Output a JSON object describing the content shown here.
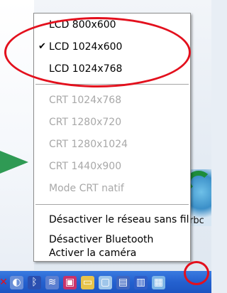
{
  "menu": {
    "items": [
      {
        "label": "LCD 800x600",
        "checked": false,
        "disabled": false
      },
      {
        "label": "LCD 1024x600",
        "checked": true,
        "disabled": false
      },
      {
        "label": "LCD 1024x768",
        "checked": false,
        "disabled": false
      },
      {
        "label": "CRT 1024x768",
        "checked": false,
        "disabled": true
      },
      {
        "label": "CRT 1280x720",
        "checked": false,
        "disabled": true
      },
      {
        "label": "CRT 1280x1024",
        "checked": false,
        "disabled": true
      },
      {
        "label": "CRT 1440x900",
        "checked": false,
        "disabled": true
      },
      {
        "label": "Mode CRT natif",
        "checked": false,
        "disabled": true
      },
      {
        "label": "Désactiver le réseau sans fil",
        "checked": false,
        "disabled": false
      },
      {
        "label": "Désactiver Bluetooth",
        "checked": false,
        "disabled": false
      },
      {
        "label": "Activer la caméra",
        "checked": false,
        "disabled": false
      }
    ],
    "check_glyph": "✔"
  },
  "desktop": {
    "right_icon_label": "rbc"
  },
  "taskbar": {
    "tray_icons": [
      "close-x-icon",
      "network-icon",
      "bluetooth-icon",
      "wireless-icon",
      "app-icon",
      "folder-icon",
      "monitor-icon",
      "keyboard-icon",
      "display-icon",
      "screen-settings-icon"
    ],
    "highlight_color": "#e3101d"
  }
}
